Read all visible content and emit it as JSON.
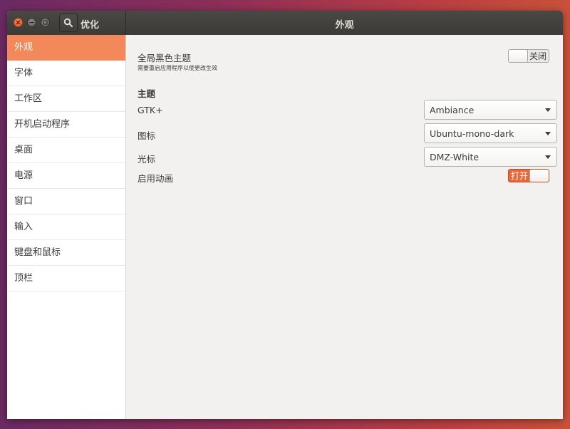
{
  "window": {
    "app_title": "优化",
    "page_title": "外观"
  },
  "sidebar": {
    "items": [
      {
        "label": "外观"
      },
      {
        "label": "字体"
      },
      {
        "label": "工作区"
      },
      {
        "label": "开机启动程序"
      },
      {
        "label": "桌面"
      },
      {
        "label": "电源"
      },
      {
        "label": "窗口"
      },
      {
        "label": "输入"
      },
      {
        "label": "键盘和鼠标"
      },
      {
        "label": "顶栏"
      }
    ],
    "active_index": 0
  },
  "appearance": {
    "dark_theme": {
      "label": "全局黑色主题",
      "hint": "需要重启应用程序以使更改生效",
      "state_label": "关闭",
      "enabled": false
    },
    "themes_heading": "主题",
    "gtk": {
      "label": "GTK+",
      "value": "Ambiance"
    },
    "icons": {
      "label": "图标",
      "value": "Ubuntu-mono-dark"
    },
    "cursor": {
      "label": "光标",
      "value": "DMZ-White"
    },
    "animations": {
      "label": "启用动画",
      "state_label": "打开",
      "enabled": true
    }
  },
  "colors": {
    "accent": "#f3885a",
    "switch_on": "#e9683a",
    "titlebar": "#3c3b37"
  }
}
